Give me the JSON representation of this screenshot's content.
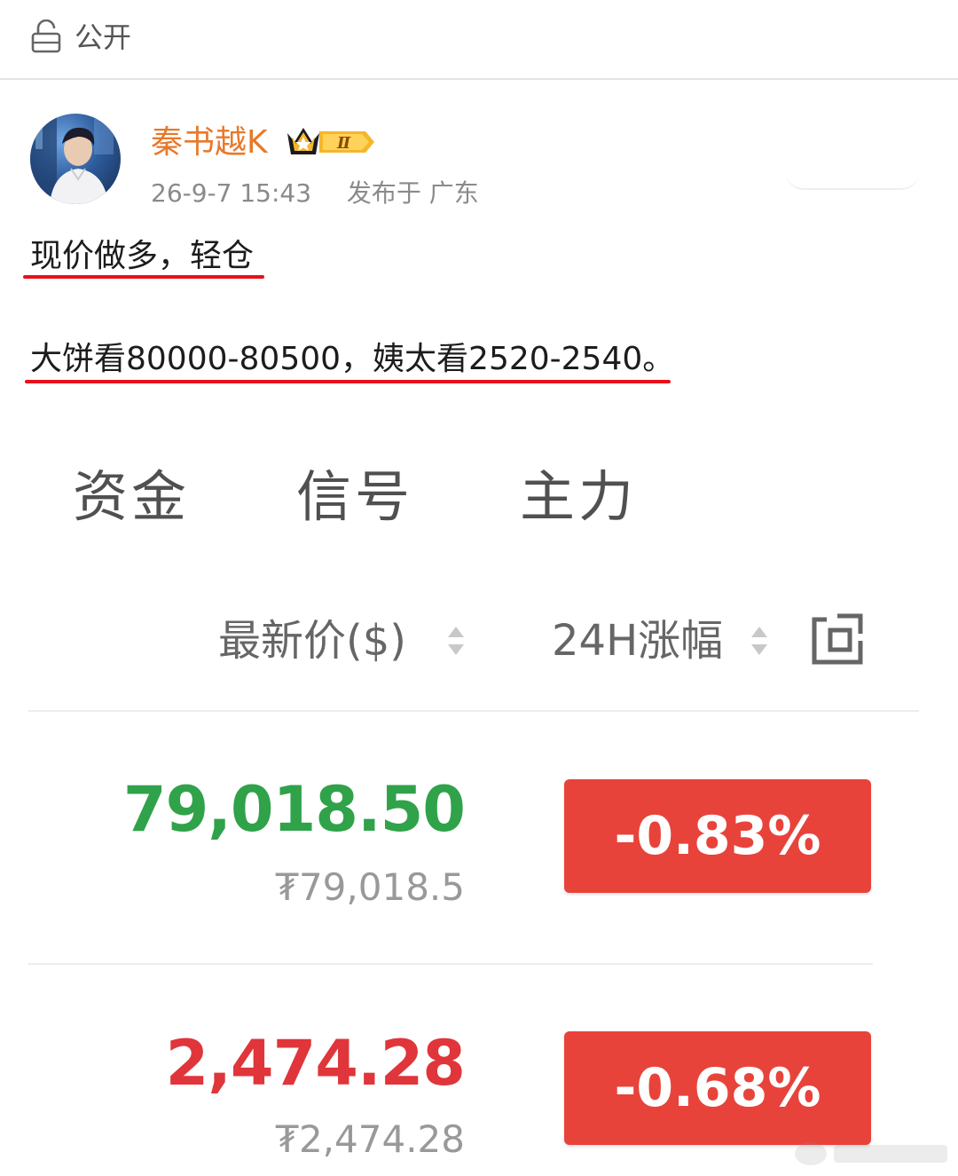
{
  "visibility": {
    "label": "公开",
    "icon": "lock-open-icon"
  },
  "author": {
    "name": "秦书越K",
    "badge": {
      "level": "Ⅱ",
      "icon": "crown-icon"
    },
    "time": "26-9-7 15:43",
    "location": "发布于 广东"
  },
  "post": {
    "line1": "现价做多，轻仓",
    "line2": "大饼看80000-80500，姨太看2520-2540。"
  },
  "market": {
    "tabs": [
      "资金",
      "信号",
      "主力"
    ],
    "columns": {
      "price": "最新价($)",
      "change": "24H涨幅"
    },
    "rows": [
      {
        "price": "79,018.50",
        "price_cny": "₮79,018.5",
        "change": "-0.83%",
        "price_color": "#30a24a"
      },
      {
        "price": "2,474.28",
        "price_cny": "₮2,474.28",
        "change": "-0.68%",
        "price_color": "#e0353a"
      }
    ]
  },
  "colors": {
    "accent_name": "#e8782a",
    "underline": "#e8101a",
    "down": "#e8433b"
  }
}
